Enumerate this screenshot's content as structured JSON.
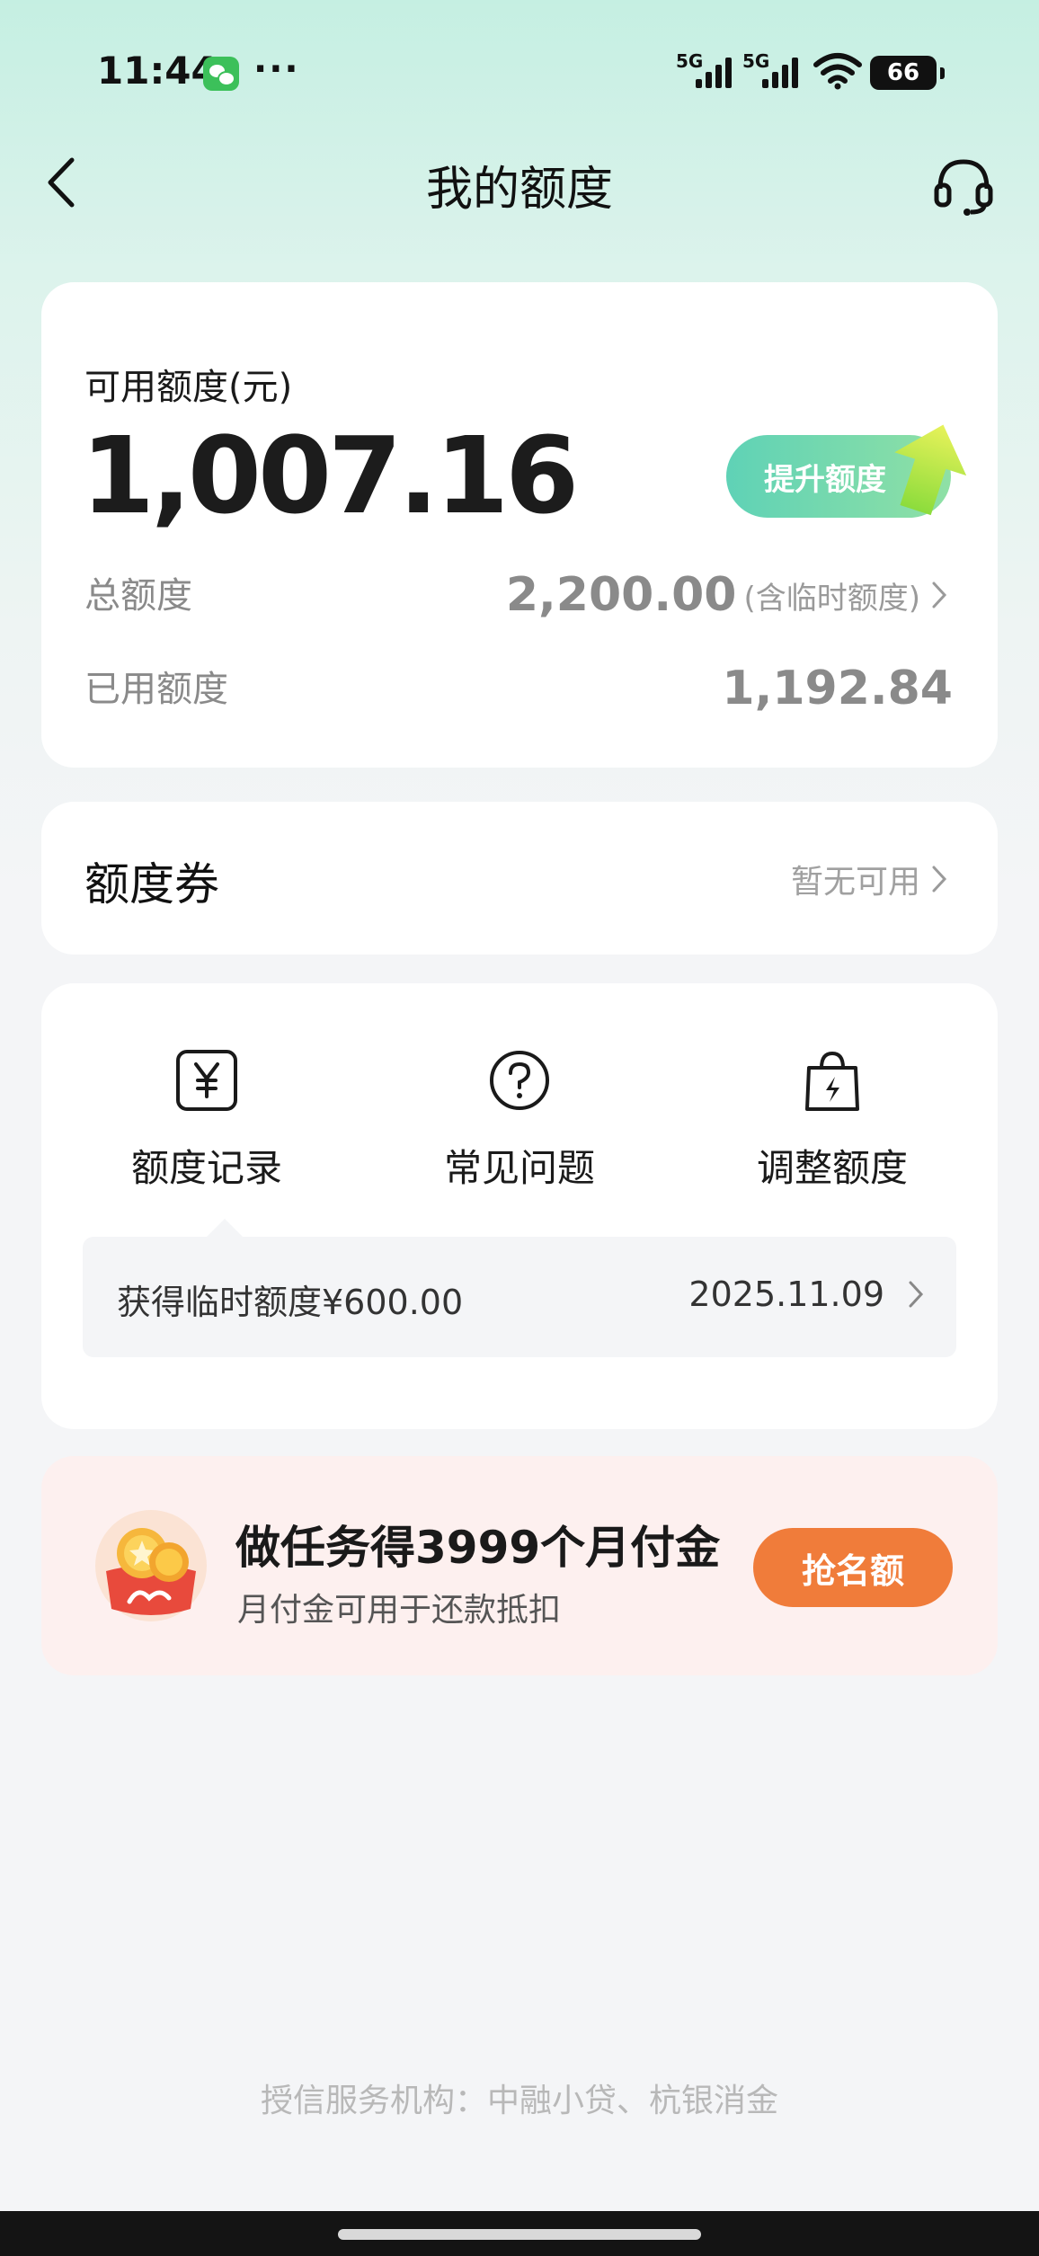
{
  "status_bar": {
    "time": "11:44",
    "signal1": "5G",
    "signal2": "5G",
    "battery": "66"
  },
  "header": {
    "title": "我的额度"
  },
  "limit_card": {
    "available_label": "可用额度(元)",
    "available_amount": "1,007.16",
    "raise_button": "提升额度",
    "total_label": "总额度",
    "total_value": "2,200.00",
    "total_note": "(含临时额度)",
    "used_label": "已用额度",
    "used_value": "1,192.84"
  },
  "coupon_card": {
    "title": "额度券",
    "status": "暂无可用"
  },
  "tools": {
    "items": [
      {
        "label": "额度记录",
        "icon": "yen-icon"
      },
      {
        "label": "常见问题",
        "icon": "question-icon"
      },
      {
        "label": "调整额度",
        "icon": "lightning-bag-icon"
      }
    ],
    "notice_text": "获得临时额度¥600.00",
    "notice_date": "2025.11.09"
  },
  "promo": {
    "title": "做任务得3999个月付金",
    "subtitle": "月付金可用于还款抵扣",
    "button": "抢名额"
  },
  "footer": {
    "text": "授信服务机构：中融小贷、杭银消金"
  },
  "colors": {
    "accent_green": "#5fd2b6",
    "promo_orange": "#f07c3a",
    "promo_bg": "#fdf0ef"
  }
}
